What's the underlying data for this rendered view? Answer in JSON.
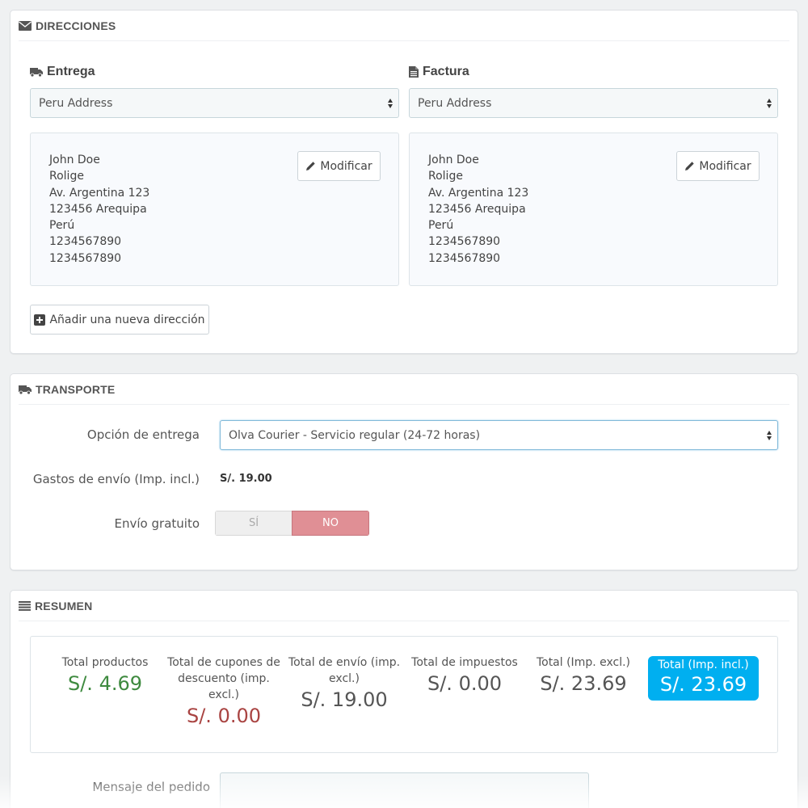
{
  "addresses": {
    "title": "DIRECCIONES",
    "delivery": {
      "title": "Entrega",
      "selected": "Peru Address",
      "lines": [
        "John Doe",
        "Rolige",
        "Av. Argentina 123",
        "123456 Arequipa",
        "Perú",
        "1234567890",
        "1234567890"
      ],
      "edit_label": "Modificar"
    },
    "invoice": {
      "title": "Factura",
      "selected": "Peru Address",
      "lines": [
        "John Doe",
        "Rolige",
        "Av. Argentina 123",
        "123456 Arequipa",
        "Perú",
        "1234567890",
        "1234567890"
      ],
      "edit_label": "Modificar"
    },
    "add_label": "Añadir una nueva dirección"
  },
  "transport": {
    "title": "TRANSPORTE",
    "delivery_option_label": "Opción de entrega",
    "delivery_option_value": "Olva Courier - Servicio regular (24-72 horas)",
    "shipping_cost_label": "Gastos de envío (Imp. incl.)",
    "shipping_cost_value": "S/. 19.00",
    "free_shipping_label": "Envío gratuito",
    "free_shipping_yes": "SÍ",
    "free_shipping_no": "NO"
  },
  "summary": {
    "title": "RESUMEN",
    "stats": [
      {
        "label": "Total productos",
        "value": "S/. 4.69",
        "color": "#3e8a3f"
      },
      {
        "label": "Total de cupones de descuento (imp. excl.)",
        "value": "S/. 0.00",
        "color": "#a94442"
      },
      {
        "label": "Total de envío (imp. excl.)",
        "value": "S/. 19.00",
        "color": "#555555"
      },
      {
        "label": "Total de impuestos",
        "value": "S/. 0.00",
        "color": "#555555"
      },
      {
        "label": "Total (Imp. excl.)",
        "value": "S/. 23.69",
        "color": "#555555"
      },
      {
        "label": "Total (Imp. incl.)",
        "value": "S/. 23.69",
        "color": "#ffffff"
      }
    ],
    "message_label": "Mensaje del pedido"
  }
}
